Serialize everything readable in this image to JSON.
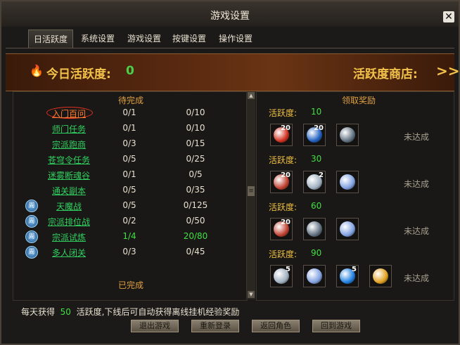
{
  "window": {
    "title": "游戏设置"
  },
  "tabs": [
    "日活跃度",
    "系统设置",
    "游戏设置",
    "按键设置",
    "操作设置"
  ],
  "active_tab": 0,
  "banner": {
    "today_label": "今日活跃度:",
    "today_value": "0",
    "shop_label": "活跃度商店:",
    "shop_arrow": ">>"
  },
  "tasks": {
    "header_pending": "待完成",
    "header_done": "已完成",
    "rows": [
      {
        "name": "入门百问",
        "col1": "0/1",
        "col2": "0/10",
        "icon": false,
        "highlight": true,
        "green": false
      },
      {
        "name": "师门任务",
        "col1": "0/1",
        "col2": "0/10",
        "icon": false,
        "highlight": false,
        "green": false
      },
      {
        "name": "宗派跑商",
        "col1": "0/3",
        "col2": "0/15",
        "icon": false,
        "highlight": false,
        "green": false
      },
      {
        "name": "苍穹令任务",
        "col1": "0/5",
        "col2": "0/25",
        "icon": false,
        "highlight": false,
        "green": false
      },
      {
        "name": "迷雾断魂谷",
        "col1": "0/1",
        "col2": "0/5",
        "icon": false,
        "highlight": false,
        "green": false
      },
      {
        "name": "通关副本",
        "col1": "0/5",
        "col2": "0/35",
        "icon": false,
        "highlight": false,
        "green": false
      },
      {
        "name": "天魔战",
        "col1": "0/5",
        "col2": "0/125",
        "icon": true,
        "highlight": false,
        "green": false
      },
      {
        "name": "宗派排位战",
        "col1": "0/2",
        "col2": "0/50",
        "icon": true,
        "highlight": false,
        "green": false
      },
      {
        "name": "宗派试炼",
        "col1": "1/4",
        "col2": "20/80",
        "icon": true,
        "highlight": false,
        "green": true
      },
      {
        "name": "多人闭关",
        "col1": "0/3",
        "col2": "0/45",
        "icon": true,
        "highlight": false,
        "green": false
      }
    ]
  },
  "rewards": {
    "header": "领取奖励",
    "tiers": [
      {
        "label": "活跃度:",
        "value": "10",
        "status": "未达成",
        "items": [
          {
            "name": "red-orb-item",
            "count": "20",
            "color": "#d03020"
          },
          {
            "name": "blue-orb-item",
            "count": "20",
            "color": "#2060c0"
          },
          {
            "name": "bowl-item",
            "count": "",
            "color": "#607080"
          }
        ]
      },
      {
        "label": "活跃度:",
        "value": "30",
        "status": "未达成",
        "items": [
          {
            "name": "fruit-plate-item",
            "count": "20",
            "color": "#c04030"
          },
          {
            "name": "silver-orb-item",
            "count": "2",
            "color": "#a0b0c0"
          },
          {
            "name": "spirit-swirl-item",
            "count": "",
            "color": "#80a0e0"
          }
        ]
      },
      {
        "label": "活跃度:",
        "value": "60",
        "status": "未达成",
        "items": [
          {
            "name": "fruit-plate-item",
            "count": "20",
            "color": "#c04030"
          },
          {
            "name": "bowl-item",
            "count": "",
            "color": "#607080"
          },
          {
            "name": "spirit-swirl-item",
            "count": "",
            "color": "#80a0e0"
          }
        ]
      },
      {
        "label": "活跃度:",
        "value": "90",
        "status": "未达成",
        "items": [
          {
            "name": "silver-orb-item",
            "count": "5",
            "color": "#a0b0c0"
          },
          {
            "name": "spirit-swirl-item",
            "count": "",
            "color": "#80a0e0"
          },
          {
            "name": "blue-orb-item",
            "count": "5",
            "color": "#2080e0"
          },
          {
            "name": "gold-ingot-item",
            "count": "",
            "color": "#e0a020"
          }
        ]
      }
    ]
  },
  "footer": {
    "prefix": "每天获得",
    "value": "50",
    "suffix": "活跃度,下线后可自动获得离线挂机经验奖励"
  },
  "buttons": [
    "退出游戏",
    "重新登录",
    "返回角色",
    "回到游戏"
  ],
  "colors": {
    "accent_gold": "#f2c24a",
    "task_green": "#30d060",
    "value_green": "#40e040"
  }
}
